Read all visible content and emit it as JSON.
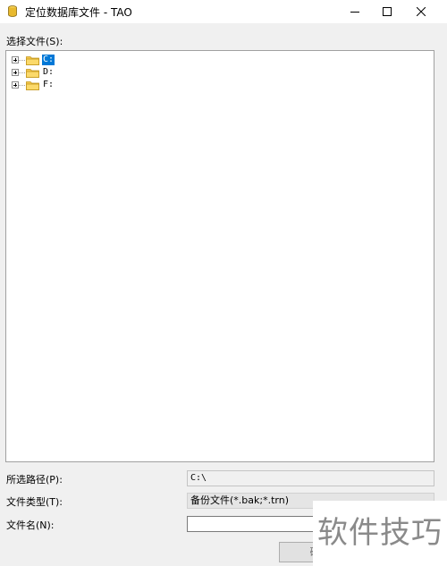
{
  "window": {
    "title": "定位数据库文件 - TAO",
    "minimize_icon": "minimize-icon",
    "maximize_icon": "maximize-icon",
    "close_icon": "close-icon"
  },
  "tree": {
    "label": "选择文件(S):",
    "items": [
      {
        "label": "C:",
        "selected": true,
        "icon": "folder-icon"
      },
      {
        "label": "D:",
        "selected": false,
        "icon": "folder-icon"
      },
      {
        "label": "F:",
        "selected": false,
        "icon": "folder-icon"
      }
    ]
  },
  "fields": {
    "path_label": "所选路径(P):",
    "path_value": "C:\\",
    "type_label": "文件类型(T):",
    "type_value": "备份文件(*.bak;*.trn)",
    "name_label": "文件名(N):",
    "name_value": ""
  },
  "buttons": {
    "ok_label": "确"
  },
  "watermark": {
    "text": "软件技巧"
  },
  "colors": {
    "selection": "#0078d7",
    "folder": "#f5c84c"
  }
}
